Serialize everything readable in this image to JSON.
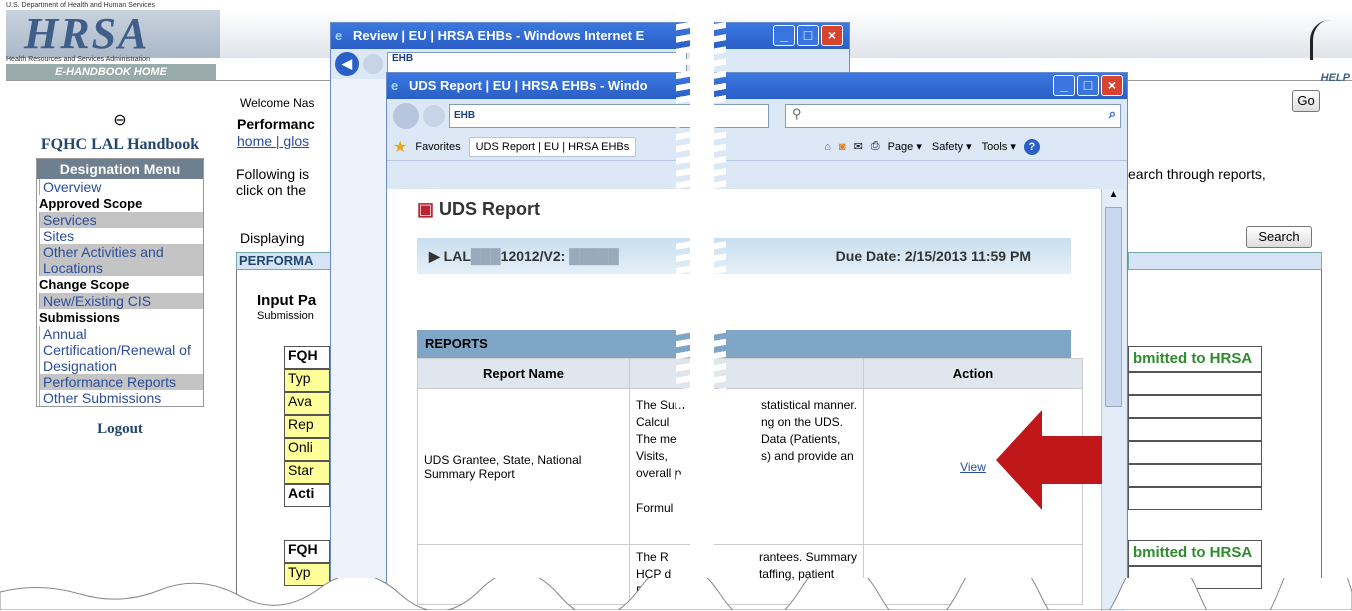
{
  "bg": {
    "hhs_line": "U.S. Department of Health and Human Services",
    "logo": "HRSA",
    "hrsa_sub": "Health Resources and Services Administration",
    "ehandbook": "E-HANDBOOK HOME",
    "help": "HELP",
    "go_label": "Go",
    "search_label": "Search",
    "welcome": "Welcome Nas",
    "performance": "Performanc",
    "links": "home | glos",
    "following": "Following is",
    "click_on": "click on the",
    "search_text": "earch through reports,",
    "displaying": "Displaying",
    "perf_band": "PERFORMA",
    "input_pa": "Input Pa",
    "submission": "Submission",
    "fq1": "FQH",
    "rows": [
      "Typ",
      "Ava",
      "Rep",
      "Onli",
      "Star",
      "Acti"
    ],
    "fq2": "FQH",
    "rows2": [
      "Typ"
    ],
    "submitted": "bmitted to HRSA",
    "submitted2": "bmitted to HRSA",
    "back_arrow": "⊖"
  },
  "nav": {
    "title": "FQHC LAL Handbook",
    "menu_head": "Designation Menu",
    "items": [
      {
        "label": "Overview",
        "type": "link"
      },
      {
        "label": "Approved Scope",
        "type": "head"
      },
      {
        "label": "Services",
        "type": "shade"
      },
      {
        "label": "Sites",
        "type": "link"
      },
      {
        "label": "Other Activities and Locations",
        "type": "shade"
      },
      {
        "label": "Change Scope",
        "type": "head"
      },
      {
        "label": "New/Existing CIS",
        "type": "shade"
      },
      {
        "label": "Submissions",
        "type": "head"
      },
      {
        "label": "Annual Certification/Renewal of Designation",
        "type": "link"
      },
      {
        "label": "Performance Reports",
        "type": "shade"
      },
      {
        "label": "Other Submissions",
        "type": "link"
      }
    ],
    "logout": "Logout"
  },
  "win1": {
    "title": "Review | EU | HRSA EHBs - Windows Internet E",
    "addr": "EHB"
  },
  "win2": {
    "title": "UDS Report | EU | HRSA EHBs - Windo",
    "addr": "EHB",
    "favorites": "Favorites",
    "tab": "UDS Report | EU | HRSA EHBs",
    "menus": [
      "Page ▾",
      "Safety ▾",
      "Tools ▾"
    ],
    "page_title": "UDS Report",
    "lal": "LAL",
    "lal_rest": "12012/V2:",
    "due": "Due Date: 2/15/2013 11:59 PM",
    "reports_head": "REPORTS",
    "col_name": "Report Name",
    "col_action": "Action",
    "row1_name": "UDS Grantee, State, National Summary Report",
    "row1_desc": [
      "The Sum",
      "Calcul",
      "The me",
      "Visits,",
      "overall p",
      "Formul"
    ],
    "row1_desc2": [
      "statistical manner.",
      "ng on the UDS.",
      "Data (Patients,",
      "s) and provide an"
    ],
    "row1_action": "View",
    "row2_desc": [
      "The R",
      "HCP d",
      "Pos"
    ],
    "row2_desc2": [
      "rantees. Summary",
      "taffing, patient"
    ]
  },
  "colors": {
    "accent": "#2a5fc7",
    "arrow": "#c0171b",
    "nav_blue": "#2a4d9a"
  }
}
